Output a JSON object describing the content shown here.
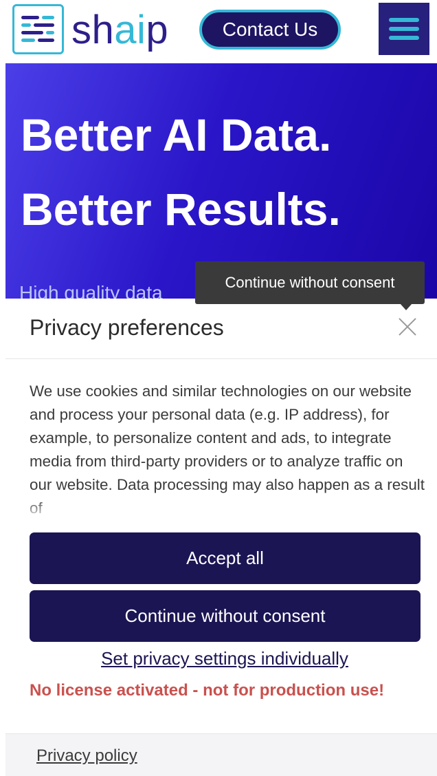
{
  "header": {
    "brand_prefix": "sh",
    "brand_ai": "ai",
    "brand_suffix": "p",
    "contact_label": "Contact Us",
    "menu_icon": "hamburger-menu-icon"
  },
  "hero": {
    "title_line1": "Better AI Data.",
    "title_line2": "Better Results.",
    "subtitle": "High quality data"
  },
  "tooltip": {
    "text": "Continue without consent"
  },
  "privacy": {
    "title": "Privacy preferences",
    "close_icon": "close-icon",
    "body": "We use cookies and similar technologies on our website and process your personal data (e.g. IP address), for example, to personalize content and ads, to integrate media from third-party providers or to analyze traffic on our website. Data processing may also happen as a result of",
    "accept_label": "Accept all",
    "continue_label": "Continue without consent",
    "settings_link": "Set privacy settings individually",
    "warning": "No license activated - not for production use!",
    "policy_link": "Privacy policy"
  },
  "colors": {
    "brand_navy": "#2c1f8a",
    "brand_cyan": "#35b8d6",
    "button_bg": "#1b1553",
    "warning": "#c9514e",
    "hero_gradient_start": "#4b3fe8",
    "hero_gradient_end": "#1a06a6"
  }
}
